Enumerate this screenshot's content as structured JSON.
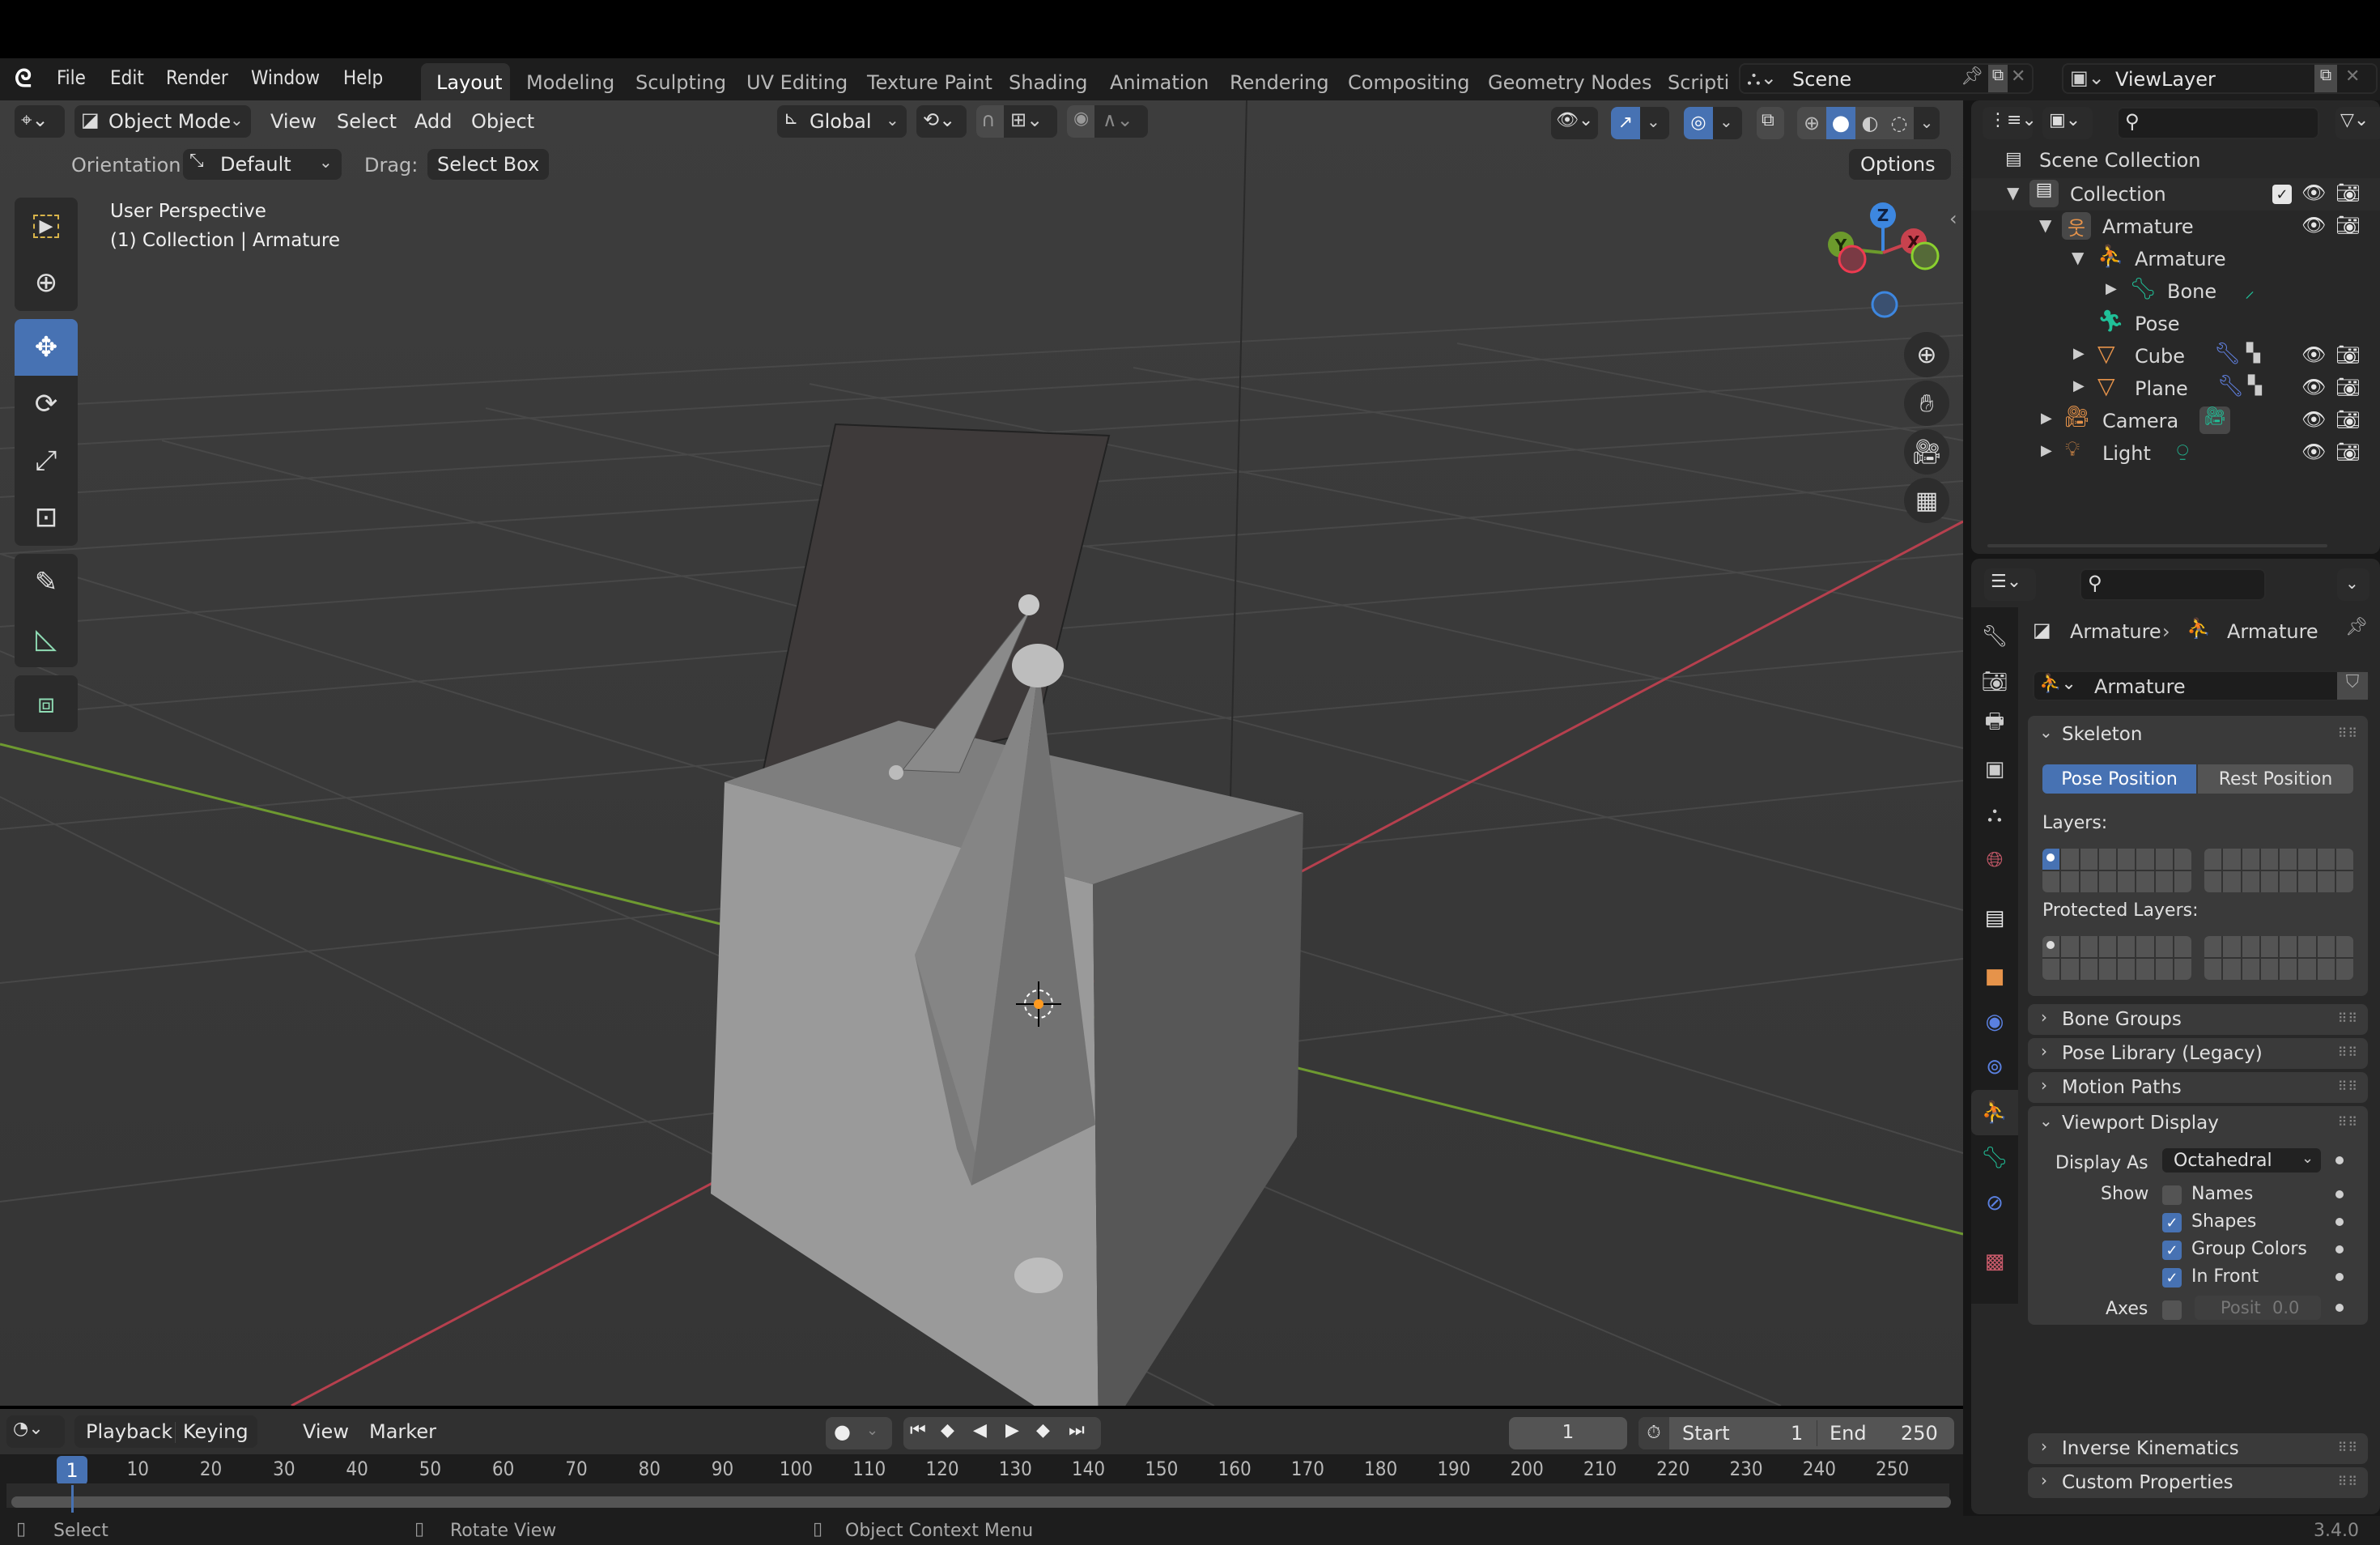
{
  "app": {
    "version": "3.4.0"
  },
  "menu": {
    "items": [
      "File",
      "Edit",
      "Render",
      "Window",
      "Help"
    ],
    "workspaces": [
      "Layout",
      "Modeling",
      "Sculpting",
      "UV Editing",
      "Texture Paint",
      "Shading",
      "Animation",
      "Rendering",
      "Compositing",
      "Geometry Nodes",
      "Scripti"
    ],
    "active_workspace": "Layout",
    "scene": "Scene",
    "view_layer": "ViewLayer"
  },
  "viewport": {
    "mode": "Object Mode",
    "menus": [
      "View",
      "Select",
      "Add",
      "Object"
    ],
    "orientation_transform": "Global",
    "tool_settings": {
      "orientation_label": "Orientation:",
      "orientation_value": "Default",
      "drag_label": "Drag:",
      "drag_value": "Select Box"
    },
    "options_label": "Options",
    "overlay_text": {
      "view_name": "User Perspective",
      "context": "(1) Collection | Armature"
    },
    "shading_active": "solid",
    "gizmo_axes": {
      "z": "Z",
      "y": "Y",
      "x": "X"
    },
    "colors": {
      "accent": "#4772b3",
      "x_axis": "#c8424e",
      "y_axis": "#6c9a2c",
      "z_axis": "#3d87e0"
    }
  },
  "outliner": {
    "root": "Scene Collection",
    "rows": [
      {
        "label": "Collection",
        "depth": 0,
        "type": "collection",
        "expanded": true,
        "visible": true,
        "renderable": true,
        "checkbox": true
      },
      {
        "label": "Armature",
        "depth": 1,
        "type": "armature-object",
        "expanded": true,
        "visible": true,
        "renderable": true
      },
      {
        "label": "Armature",
        "depth": 2,
        "type": "armature-data",
        "expanded": true
      },
      {
        "label": "Bone",
        "depth": 3,
        "type": "bone",
        "expanded": false
      },
      {
        "label": "Pose",
        "depth": 2,
        "type": "pose"
      },
      {
        "label": "Cube",
        "depth": 2,
        "type": "mesh",
        "expanded": false,
        "visible": true,
        "renderable": true,
        "modifier": true
      },
      {
        "label": "Plane",
        "depth": 2,
        "type": "mesh",
        "expanded": false,
        "visible": true,
        "renderable": true,
        "modifier": true
      },
      {
        "label": "Camera",
        "depth": 1,
        "type": "camera",
        "expanded": false,
        "visible": true,
        "renderable": true
      },
      {
        "label": "Light",
        "depth": 1,
        "type": "light",
        "expanded": false,
        "visible": true,
        "renderable": true
      }
    ]
  },
  "properties": {
    "breadcrumb": [
      "Armature",
      "Armature"
    ],
    "datablock_name": "Armature",
    "tabs": [
      "tool",
      "render",
      "output",
      "view-layer",
      "scene",
      "world",
      "collection",
      "object",
      "physics",
      "constraints",
      "armature-data",
      "bone",
      "bone-constraints",
      "texture"
    ],
    "active_tab": "armature-data",
    "skeleton": {
      "title": "Skeleton",
      "pose_position": "Pose Position",
      "rest_position": "Rest Position",
      "active_position": "Pose Position",
      "layers_label": "Layers:",
      "protected_layers_label": "Protected Layers:"
    },
    "collapsed_panels_top": [
      "Bone Groups",
      "Pose Library (Legacy)",
      "Motion Paths"
    ],
    "viewport_display": {
      "title": "Viewport Display",
      "display_as_label": "Display As",
      "display_as_value": "Octahedral",
      "show_label": "Show",
      "options": [
        {
          "label": "Names",
          "checked": false
        },
        {
          "label": "Shapes",
          "checked": true
        },
        {
          "label": "Group Colors",
          "checked": true
        },
        {
          "label": "In Front",
          "checked": true
        }
      ],
      "axes_label": "Axes",
      "axes_checked": false,
      "axes_position_label": "Posit",
      "axes_position_value": "0.0"
    },
    "collapsed_panels_bottom": [
      "Inverse Kinematics",
      "Custom Properties"
    ]
  },
  "timeline": {
    "menus": [
      "Playback",
      "Keying",
      "View",
      "Marker"
    ],
    "current_frame": "1",
    "start_label": "Start",
    "start": "1",
    "end_label": "End",
    "end": "250",
    "ticks": [
      "10",
      "20",
      "30",
      "40",
      "50",
      "60",
      "70",
      "80",
      "90",
      "100",
      "110",
      "120",
      "130",
      "140",
      "150",
      "160",
      "170",
      "180",
      "190",
      "200",
      "210",
      "220",
      "230",
      "240",
      "250"
    ],
    "playhead": "1"
  },
  "statusbar": {
    "hints": [
      "Select",
      "Rotate View",
      "Object Context Menu"
    ]
  }
}
